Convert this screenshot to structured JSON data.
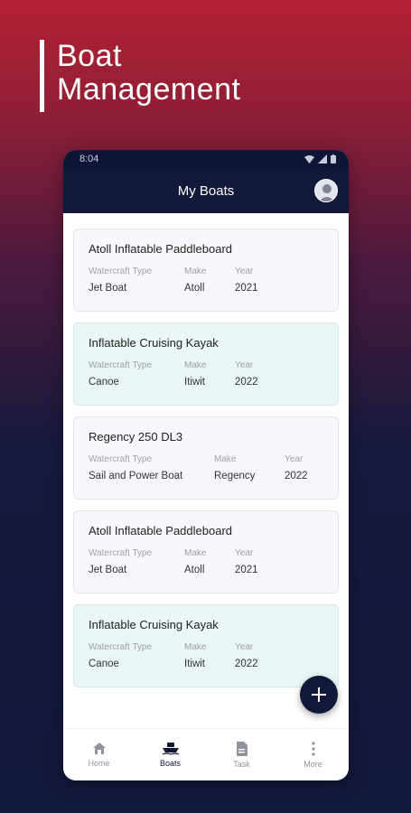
{
  "hero": {
    "title_line1": "Boat",
    "title_line2": "Management"
  },
  "status_bar": {
    "time": "8:04"
  },
  "app_bar": {
    "title": "My Boats"
  },
  "field_labels": {
    "type": "Watercraft Type",
    "make": "Make",
    "year": "Year"
  },
  "boats": [
    {
      "name": "Atoll Inflatable Paddleboard",
      "type": "Jet Boat",
      "make": "Atoll",
      "year": "2021"
    },
    {
      "name": "Inflatable Cruising Kayak",
      "type": "Canoe",
      "make": "Itiwit",
      "year": "2022"
    },
    {
      "name": "Regency 250 DL3",
      "type": "Sail and Power Boat",
      "make": "Regency",
      "year": "2022"
    },
    {
      "name": "Atoll Inflatable Paddleboard",
      "type": "Jet Boat",
      "make": "Atoll",
      "year": "2021"
    },
    {
      "name": "Inflatable Cruising Kayak",
      "type": "Canoe",
      "make": "Itiwit",
      "year": "2022"
    }
  ],
  "nav": {
    "home": "Home",
    "boats": "Boats",
    "task": "Task",
    "more": "More"
  },
  "colors": {
    "accent": "#121838",
    "card_teal": "#e9f6f5",
    "card_plain": "#f8f8fc"
  }
}
